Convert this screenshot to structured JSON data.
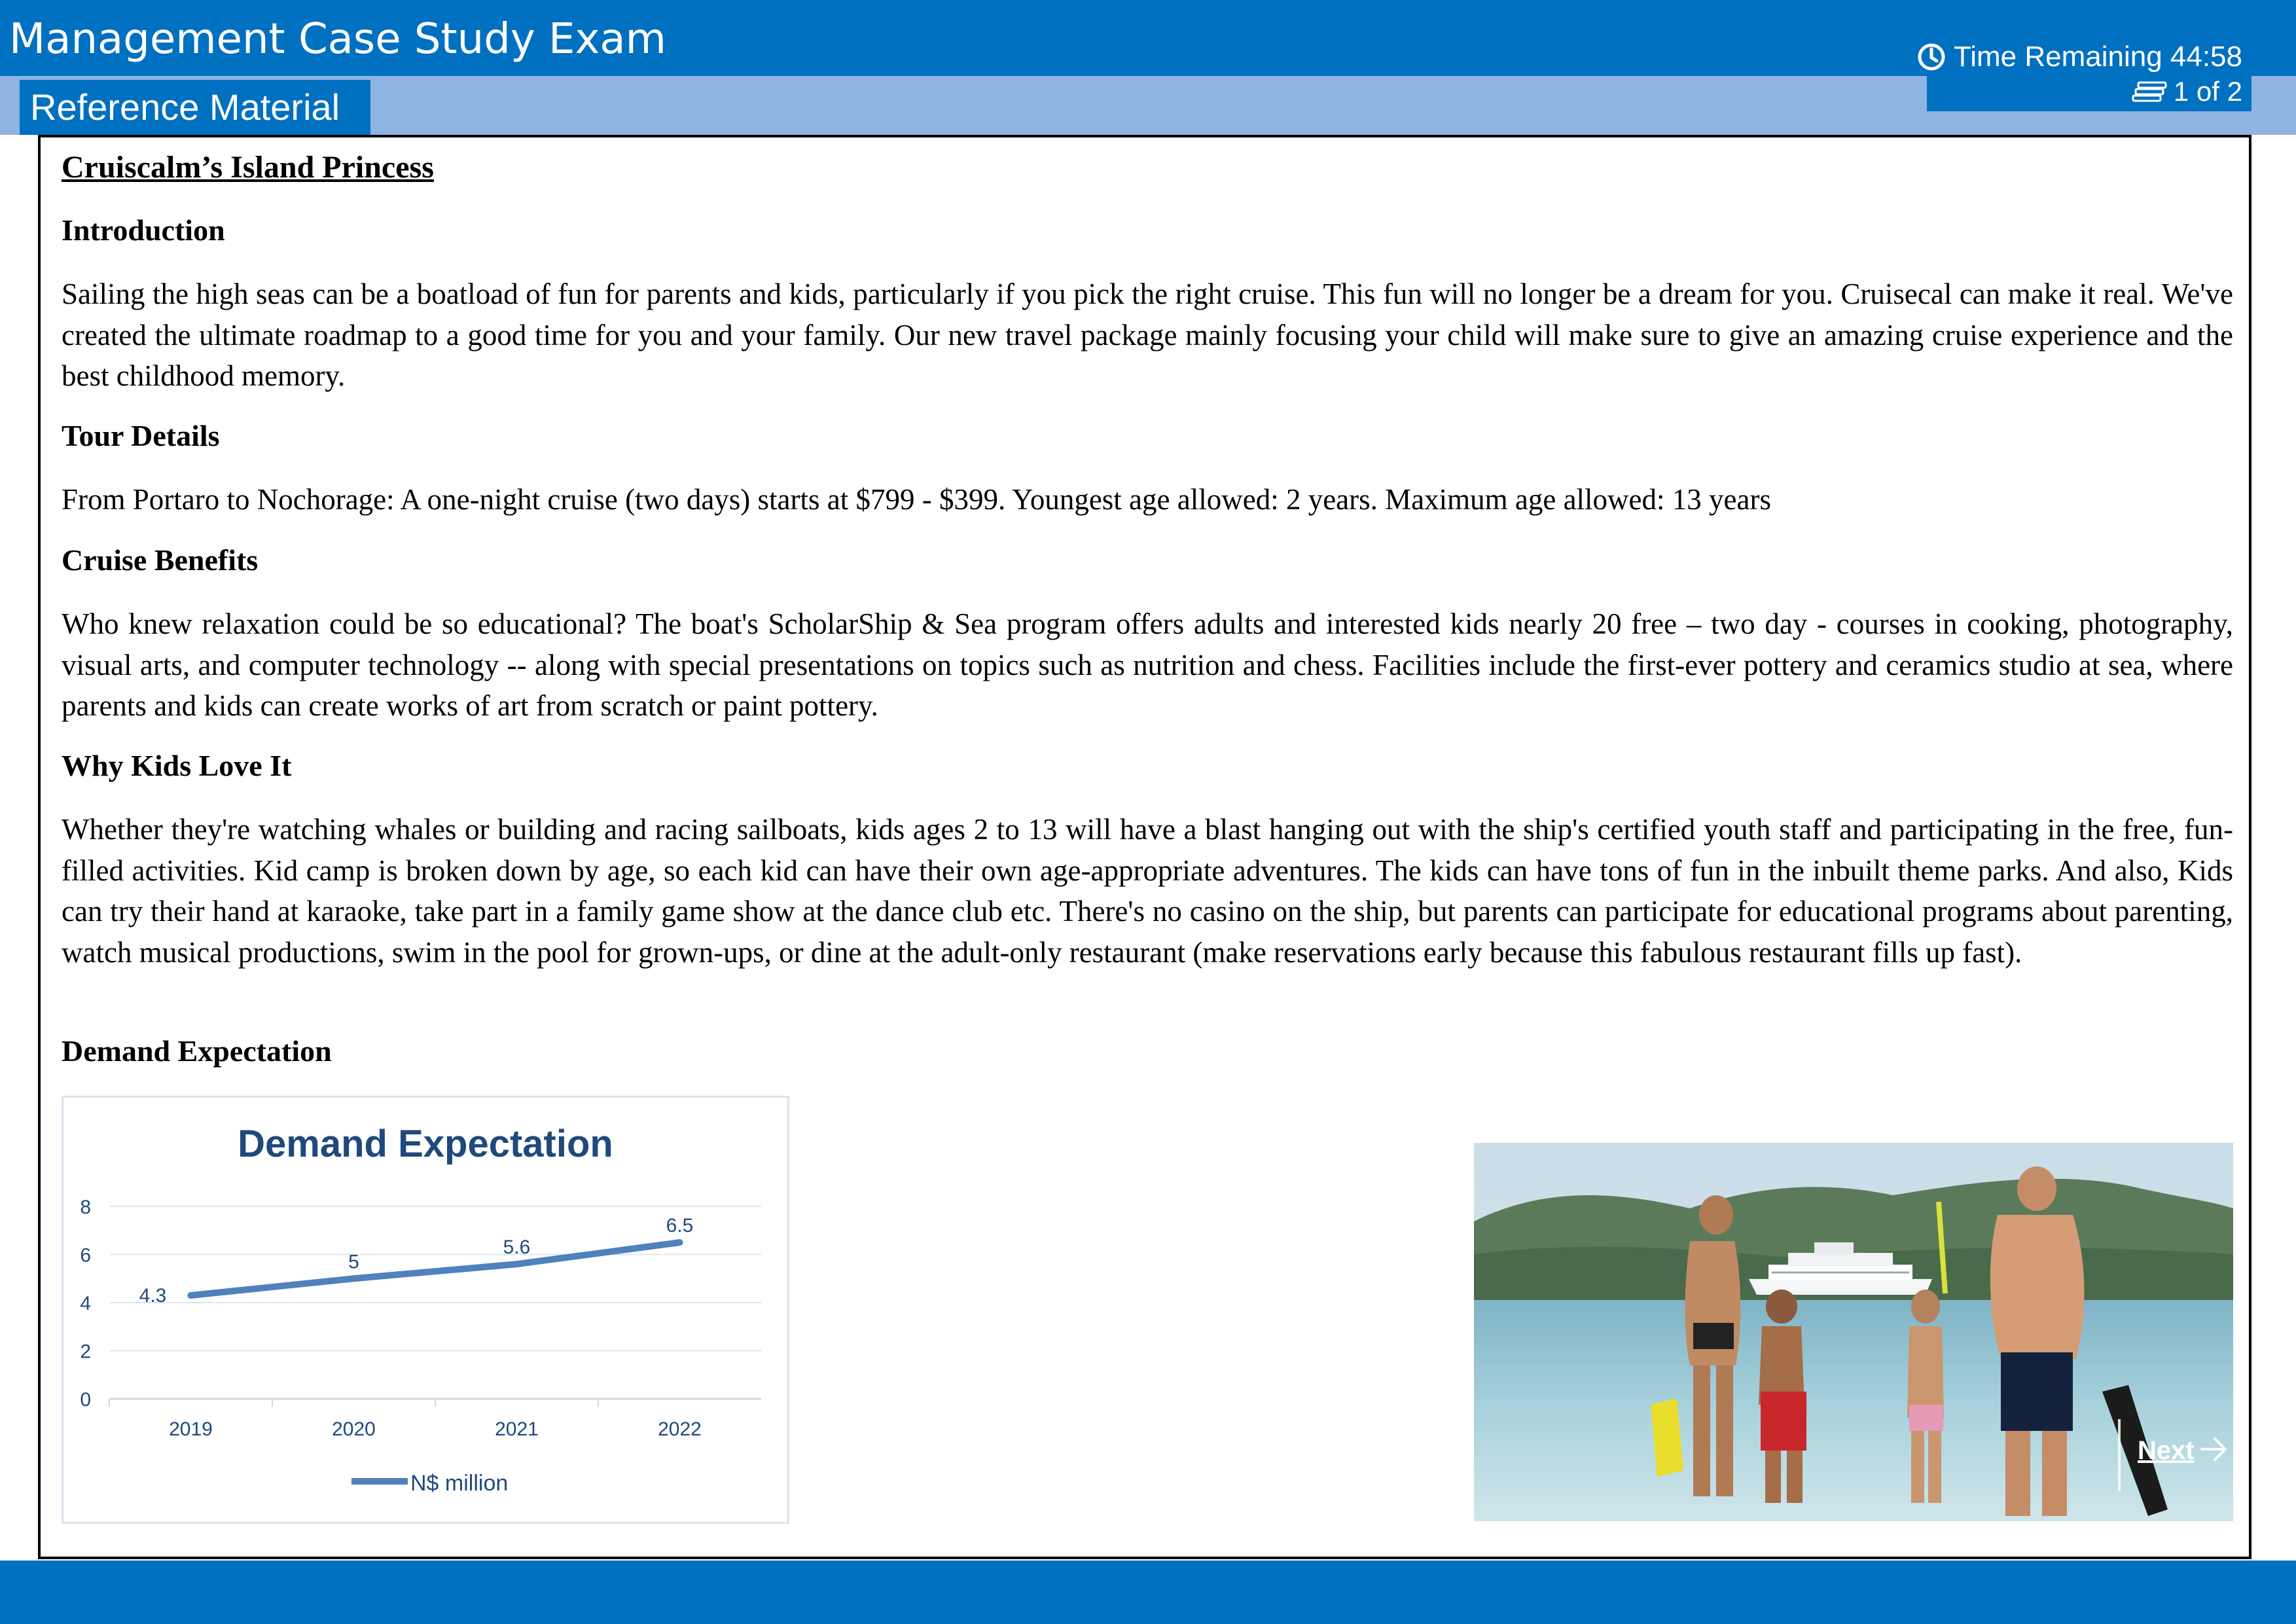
{
  "header": {
    "app_title": "Management Case Study Exam",
    "tab_label": "Reference Material",
    "timer_text": "Time Remaining 44:58",
    "page_indicator": "1 of 2"
  },
  "document": {
    "title": "Cruiscalm’s Island Princess",
    "sections": [
      {
        "heading": "Introduction",
        "text": "Sailing the high seas can be a boatload of fun for parents and kids, particularly if you pick the right cruise. This fun will no longer be a dream for you. Cruisecal can make it real. We've created the ultimate roadmap to a good time for you and your family. Our new travel package mainly focusing your child will make sure to give an amazing cruise experience and the best childhood memory."
      },
      {
        "heading": "Tour Details",
        "text": "From Portaro to Nochorage: A one-night cruise (two days) starts at $799 - $399. Youngest age allowed: 2 years. Maximum age allowed: 13 years"
      },
      {
        "heading": "Cruise Benefits",
        "text": "Who knew relaxation could be so educational? The boat's ScholarShip & Sea program offers adults and interested kids nearly 20 free – two day - courses in cooking, photography, visual arts, and computer technology -- along with special presentations on topics such as nutrition and chess. Facilities include the first-ever pottery and ceramics studio at sea, where parents and kids can create works of art from scratch or paint pottery."
      },
      {
        "heading": "Why Kids Love It",
        "text": "Whether they're watching whales or building and racing sailboats, kids ages 2 to 13 will have a blast hanging out with the ship's certified youth staff and participating in the free, fun-filled activities. Kid camp is broken down by age, so each kid can have their own age-appropriate adventures. The kids can have tons of fun in the inbuilt theme parks. And also, Kids can try their hand at karaoke, take part in a family game show at the dance club etc. There's no casino on the ship, but parents can participate for educational programs about parenting, watch musical productions, swim in the pool for grown-ups, or dine at the adult-only restaurant (make reservations early because this fabulous restaurant fills up fast)."
      },
      {
        "heading": "Demand Expectation",
        "text": ""
      }
    ]
  },
  "chart_data": {
    "type": "line",
    "title": "Demand Expectation",
    "categories": [
      "2019",
      "2020",
      "2021",
      "2022"
    ],
    "series": [
      {
        "name": "N$ million",
        "values": [
          4.3,
          5,
          5.6,
          6.5
        ],
        "color": "#4f81bd"
      }
    ],
    "ylim": [
      0,
      8
    ],
    "yticks": [
      0,
      2,
      4,
      6,
      8
    ],
    "data_labels": [
      "4.3",
      "5",
      "5.6",
      "6.5"
    ],
    "grid": true,
    "legend_position": "bottom",
    "title_color": "#1f497d"
  },
  "photo": {
    "subject": "family at beach with cruise ship",
    "next_label": "Next"
  },
  "colors": {
    "header_blue": "#0070c0",
    "subbar_blue": "#8db4e2"
  }
}
